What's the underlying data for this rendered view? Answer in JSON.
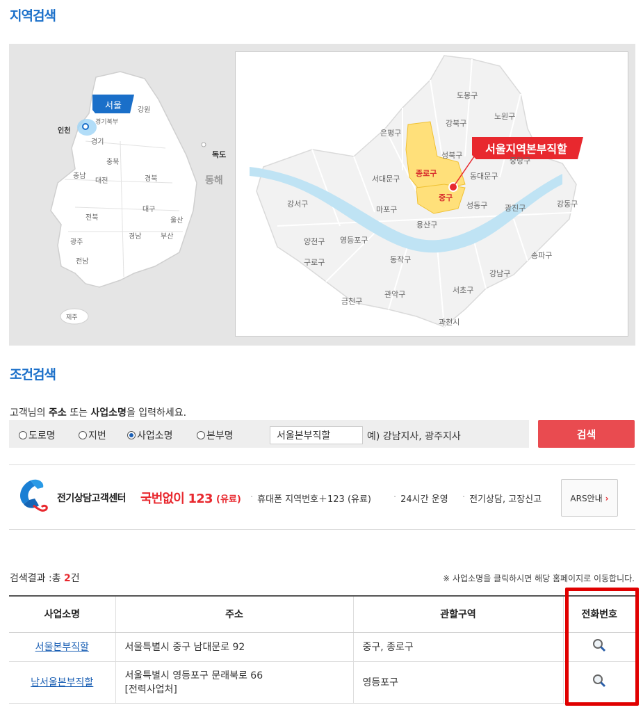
{
  "region_search": {
    "title": "지역검색",
    "korea_map": {
      "regions": [
        "서울",
        "강원",
        "인천",
        "경기북부",
        "경기",
        "충북",
        "충남",
        "대전",
        "경북",
        "독도",
        "동해",
        "전북",
        "대구",
        "울산",
        "광주",
        "경남",
        "부산",
        "전남",
        "제주"
      ],
      "selected": "서울"
    },
    "seoul_map": {
      "districts": [
        "도봉구",
        "노원구",
        "강북구",
        "은평구",
        "성북구",
        "중랑구",
        "종로구",
        "동대문구",
        "서대문구",
        "강서구",
        "마포구",
        "중구",
        "성동구",
        "광진구",
        "강동구",
        "용산구",
        "양천구",
        "영등포구",
        "구로구",
        "동작구",
        "강남구",
        "송파구",
        "서초구",
        "금천구",
        "관악구",
        "과천시"
      ],
      "highlighted": [
        "종로구",
        "중구"
      ],
      "callout": "서울지역본부직할"
    }
  },
  "condition_search": {
    "title": "조건검색",
    "prompt": {
      "prefix": "고객님의 ",
      "b1": "주소",
      "mid": " 또는 ",
      "b2": "사업소명",
      "suffix": "을 입력하세요."
    },
    "radios": [
      {
        "label": "도로명",
        "checked": false
      },
      {
        "label": "지번",
        "checked": false
      },
      {
        "label": "사업소명",
        "checked": true
      },
      {
        "label": "본부명",
        "checked": false
      }
    ],
    "input_value": "서울본부직할",
    "example": "예) 강남지사, 광주지사",
    "search_label": "검색"
  },
  "call_center": {
    "name": "전기상담고객센터",
    "number": "국번없이 123",
    "paid": "(유료)",
    "info": [
      "휴대폰 지역번호＋123 (유료)",
      "24시간 운영",
      "전기상담, 고장신고"
    ],
    "ars_label": "ARS안내"
  },
  "results": {
    "count_prefix": "검색결과 :총 ",
    "count": "2",
    "count_suffix": "건",
    "note": "※ 사업소명을 클릭하시면 해당 홈페이지로 이동합니다.",
    "columns": [
      "사업소명",
      "주소",
      "관할구역",
      "전화번호"
    ],
    "rows": [
      {
        "name": "서울본부직할",
        "address": "서울특별시 중구 남대문로 92",
        "address2": "",
        "area": "중구, 종로구"
      },
      {
        "name": "남서울본부직할",
        "address": "서울특별시 영등포구 문래북로 66",
        "address2": "[전력사업처]",
        "area": "영등포구"
      }
    ]
  },
  "colors": {
    "accent_blue": "#1a6fc9",
    "accent_red": "#e94b50",
    "highlight_red": "#e00000"
  }
}
